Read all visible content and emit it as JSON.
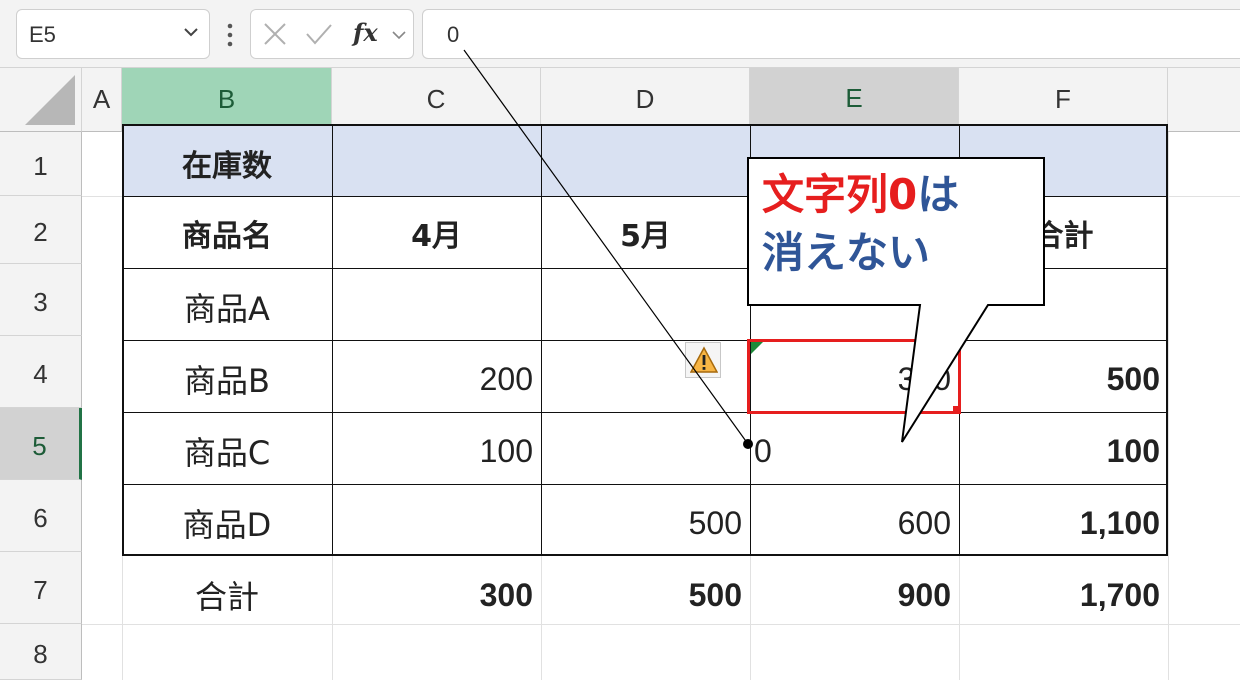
{
  "formula_bar": {
    "name_box": "E5",
    "formula_value": "0",
    "fx_label": "fx"
  },
  "columns": [
    "A",
    "B",
    "C",
    "D",
    "E",
    "F"
  ],
  "rows": [
    "1",
    "2",
    "3",
    "4",
    "5",
    "6",
    "7",
    "8"
  ],
  "cells": {
    "B1": "在庫数",
    "B2": "商品名",
    "C2": "4月",
    "D2": "5月",
    "F2": "合計",
    "B3": "商品A",
    "B4": "商品B",
    "C4": "200",
    "E4": "300",
    "F4": "500",
    "B5": "商品C",
    "C5": "100",
    "E5": "0",
    "F5": "100",
    "B6": "商品D",
    "D6": "500",
    "E6": "600",
    "F6": "1,100",
    "B7": "合計",
    "C7": "300",
    "D7": "500",
    "E7": "900",
    "F7": "1,700"
  },
  "callout": {
    "line1_red": "文字列0",
    "line1_blue": "は",
    "line2_blue": "消えない"
  },
  "colors": {
    "selection_border": "#e61e1e",
    "header_fill": "#d9e1f2",
    "selected_column_header": "#9fd5b7",
    "excel_green": "#217346",
    "callout_red": "#e61e1e",
    "callout_blue": "#2f5597"
  },
  "icons": {
    "warning": "warning-triangle-icon",
    "cancel": "cancel-x-icon",
    "enter": "checkmark-icon"
  }
}
